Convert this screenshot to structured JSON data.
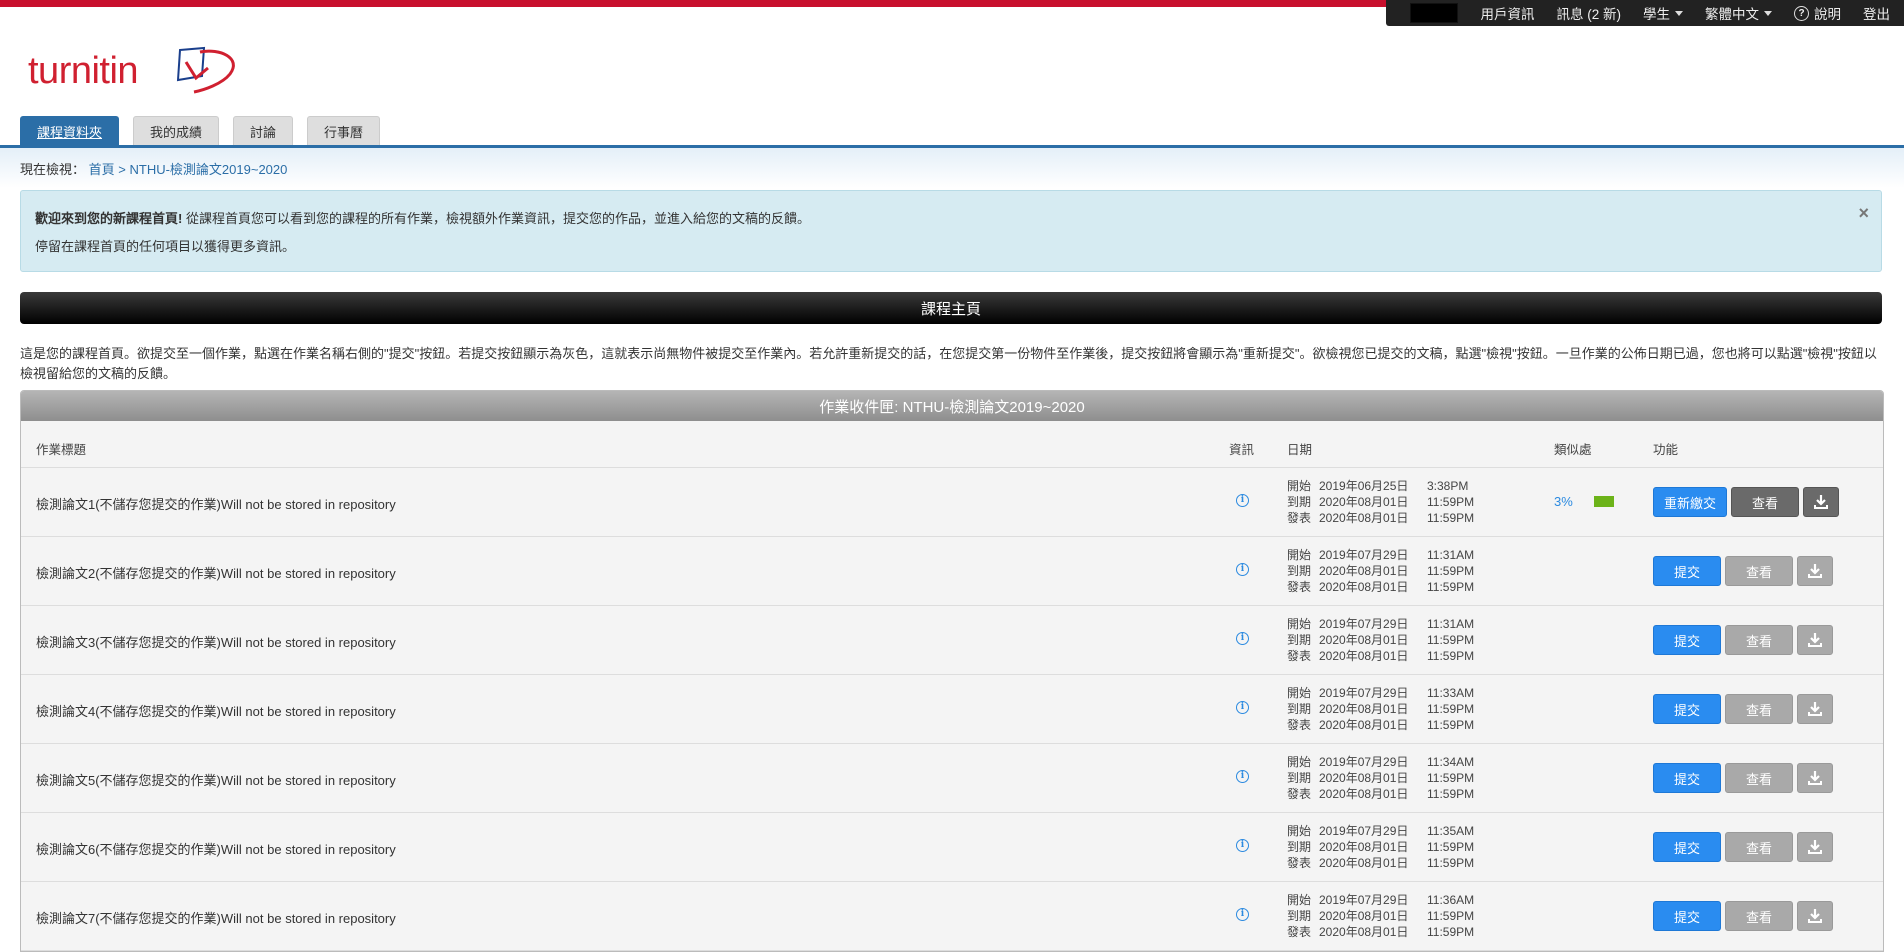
{
  "topnav": {
    "user_info": "用戶資訊",
    "messages": "訊息 (2 新)",
    "role": "學生",
    "language": "繁體中文",
    "help": "說明",
    "logout": "登出"
  },
  "brand": {
    "logo_text": "turnitin",
    "accent": "#c8102e"
  },
  "tabs": [
    {
      "label": "課程資料夾",
      "active": true
    },
    {
      "label": "我的成績"
    },
    {
      "label": "討論"
    },
    {
      "label": "行事曆"
    }
  ],
  "breadcrumb": {
    "prefix": "現在檢視：",
    "home": "首頁",
    "separator": ">",
    "current": "NTHU-檢測論文2019~2020"
  },
  "alert": {
    "bold": "歡迎來到您的新課程首頁!",
    "text": "從課程首頁您可以看到您的課程的所有作業，檢視額外作業資訊，提交您的作品，並進入給您的文稿的反饋。",
    "line2": "停留在課程首頁的任何項目以獲得更多資訊。",
    "close": "×"
  },
  "section_title": "課程主頁",
  "description": "這是您的課程首頁。欲提交至一個作業，點選在作業名稱右側的\"提交\"按鈕。若提交按鈕顯示為灰色，這就表示尚無物件被提交至作業內。若允許重新提交的話，在您提交第一份物件至作業後，提交按鈕將會顯示為\"重新提交\"。欲檢視您已提交的文稿，點選\"檢視\"按鈕。一旦作業的公佈日期已過，您也將可以點選\"檢視\"按鈕以檢視留給您的文稿的反饋。",
  "inbox": {
    "title": "作業收件匣: NTHU-檢測論文2019~2020",
    "columns": {
      "title": "作業標題",
      "info": "資訊",
      "dates": "日期",
      "similarity": "類似處",
      "actions": "功能"
    },
    "date_labels": {
      "start": "開始",
      "due": "到期",
      "post": "發表"
    },
    "buttons": {
      "resubmit": "重新繳交",
      "submit": "提交",
      "view": "查看"
    },
    "rows": [
      {
        "title": "檢測論文1(不儲存您提交的作業)Will not be stored in repository",
        "start_date": "2019年06月25日",
        "start_time": "3:38PM",
        "due_date": "2020年08月01日",
        "due_time": "11:59PM",
        "post_date": "2020年08月01日",
        "post_time": "11:59PM",
        "similarity": "3%",
        "submitted": true
      },
      {
        "title": "檢測論文2(不儲存您提交的作業)Will not be stored in repository",
        "start_date": "2019年07月29日",
        "start_time": "11:31AM",
        "due_date": "2020年08月01日",
        "due_time": "11:59PM",
        "post_date": "2020年08月01日",
        "post_time": "11:59PM",
        "similarity": "",
        "submitted": false
      },
      {
        "title": "檢測論文3(不儲存您提交的作業)Will not be stored in repository",
        "start_date": "2019年07月29日",
        "start_time": "11:31AM",
        "due_date": "2020年08月01日",
        "due_time": "11:59PM",
        "post_date": "2020年08月01日",
        "post_time": "11:59PM",
        "similarity": "",
        "submitted": false
      },
      {
        "title": "檢測論文4(不儲存您提交的作業)Will not be stored in repository",
        "start_date": "2019年07月29日",
        "start_time": "11:33AM",
        "due_date": "2020年08月01日",
        "due_time": "11:59PM",
        "post_date": "2020年08月01日",
        "post_time": "11:59PM",
        "similarity": "",
        "submitted": false
      },
      {
        "title": "檢測論文5(不儲存您提交的作業)Will not be stored in repository",
        "start_date": "2019年07月29日",
        "start_time": "11:34AM",
        "due_date": "2020年08月01日",
        "due_time": "11:59PM",
        "post_date": "2020年08月01日",
        "post_time": "11:59PM",
        "similarity": "",
        "submitted": false
      },
      {
        "title": "檢測論文6(不儲存您提交的作業)Will not be stored in repository",
        "start_date": "2019年07月29日",
        "start_time": "11:35AM",
        "due_date": "2020年08月01日",
        "due_time": "11:59PM",
        "post_date": "2020年08月01日",
        "post_time": "11:59PM",
        "similarity": "",
        "submitted": false
      },
      {
        "title": "檢測論文7(不儲存您提交的作業)Will not be stored in repository",
        "start_date": "2019年07月29日",
        "start_time": "11:36AM",
        "due_date": "2020年08月01日",
        "due_time": "11:59PM",
        "post_date": "2020年08月01日",
        "post_time": "11:59PM",
        "similarity": "",
        "submitted": false
      }
    ]
  }
}
